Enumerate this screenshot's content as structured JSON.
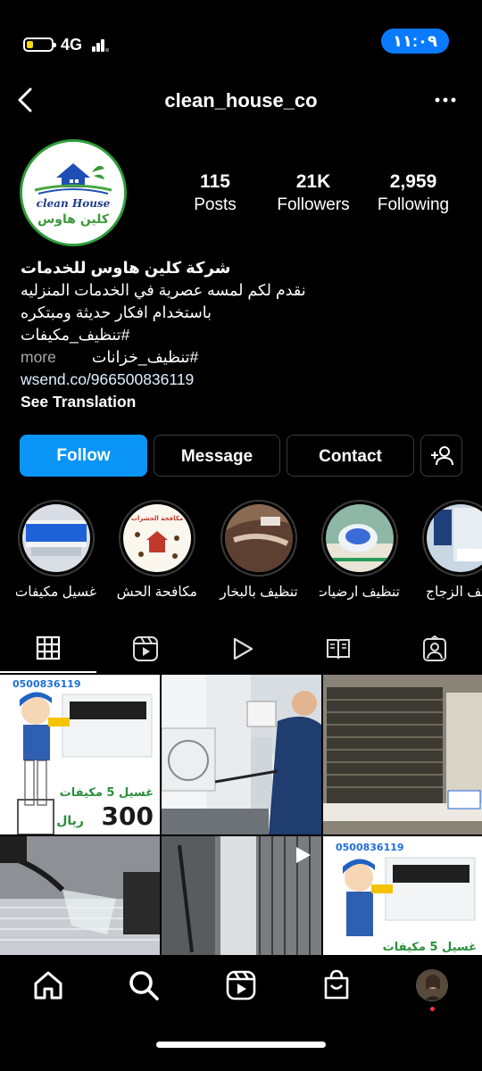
{
  "status_bar": {
    "network": "4G",
    "time": "١١:٠٩",
    "battery_level": 0.25
  },
  "header": {
    "username": "clean_house_co"
  },
  "profile": {
    "logo_text_en": "clean House",
    "logo_text_ar": "كلين هاوس",
    "stats": [
      {
        "value": "115",
        "label": "Posts"
      },
      {
        "value": "21K",
        "label": "Followers"
      },
      {
        "value": "2,959",
        "label": "Following"
      }
    ],
    "bio": {
      "name": "شركة كلين هاوس للخدمات",
      "line1": "نقدم لكم لمسه عصرية في الخدمات المنزليه",
      "line2": "باستخدام افكار حديثة ومبتكره",
      "line3": "#تنظيف_مكيفات",
      "line4": "#تنظيف_خزانات",
      "more": "more",
      "link": "wsend.co/966500836119",
      "see_translation": "See Translation"
    }
  },
  "actions": {
    "follow": "Follow",
    "message": "Message",
    "contact": "Contact"
  },
  "highlights": [
    {
      "label": "غسيل مكيفات"
    },
    {
      "label": "مكافحة الحش...",
      "badge": "مكافحة الحشرات"
    },
    {
      "label": "تنظيف بالبخار"
    },
    {
      "label": "تنظيف ارضيات"
    },
    {
      "label": "تنظيف الزجاج"
    }
  ],
  "tabs": [
    "grid",
    "reels",
    "videos",
    "guides",
    "tagged"
  ],
  "posts": [
    {
      "phone": "0500836119",
      "promo_line": "غسيل 5 مكيفات",
      "price": "300",
      "currency": "ريال"
    },
    {},
    {},
    {},
    {
      "video": true
    },
    {
      "phone": "0500836119",
      "promo_line": "غسيل 5 مكيفات"
    }
  ],
  "colors": {
    "accent": "#0a95f6",
    "status_pill": "#0a7bff",
    "background": "#000000",
    "border": "#3a3a3a",
    "notification_dot": "#ff3040"
  }
}
